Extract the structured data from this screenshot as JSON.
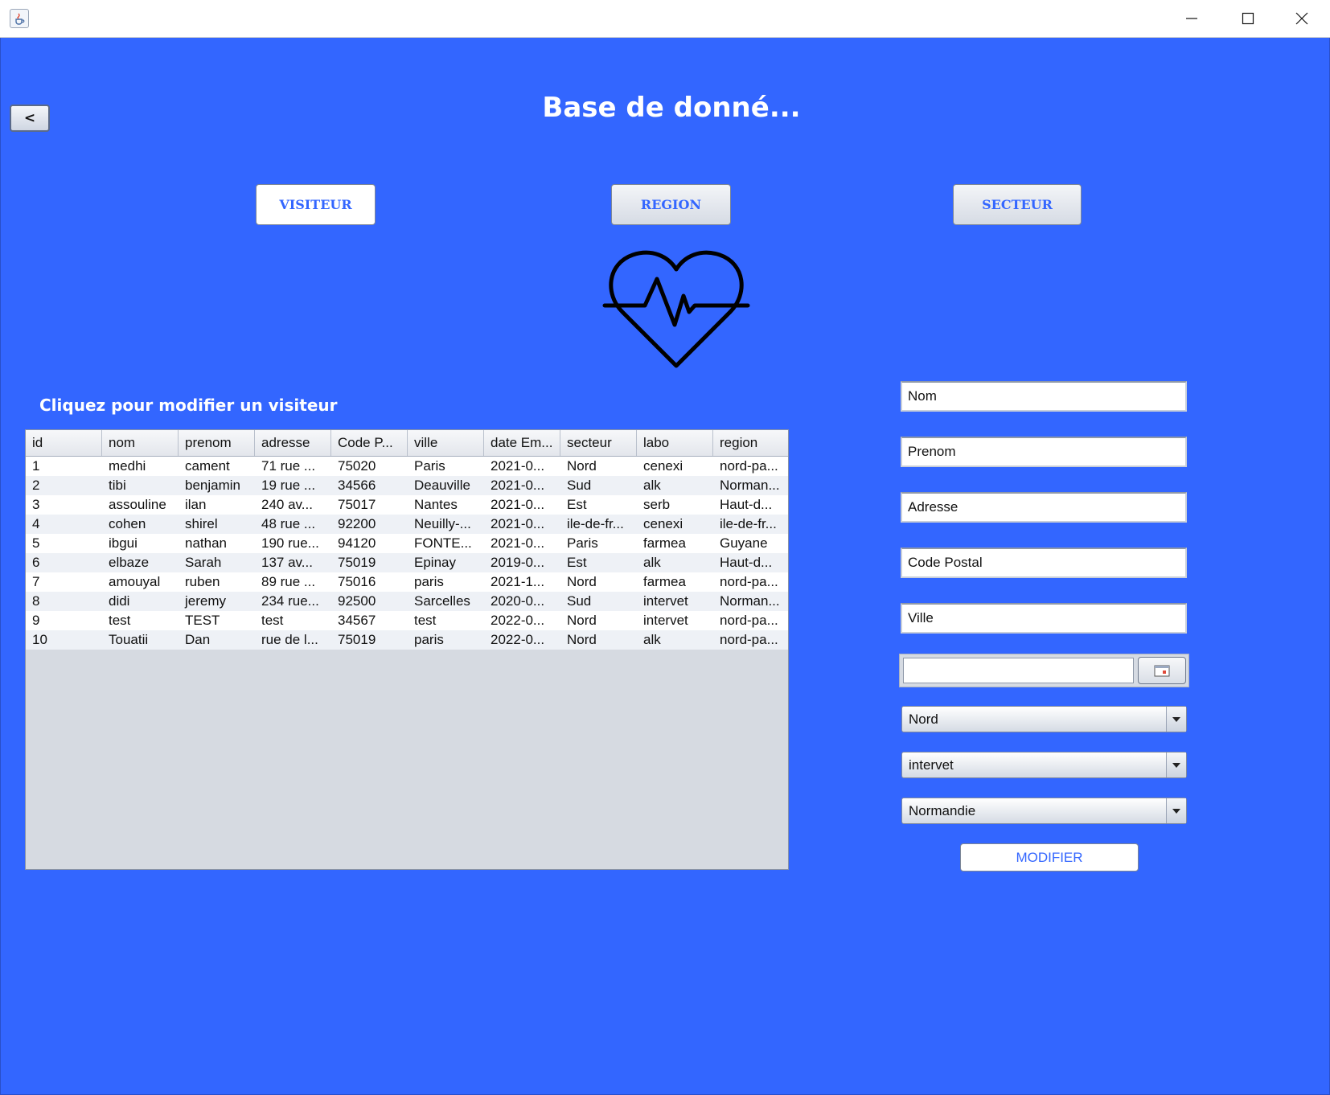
{
  "window": {
    "app_icon": "java-cup-icon",
    "controls": [
      "minimize-icon",
      "maximize-icon",
      "close-icon"
    ]
  },
  "header": {
    "back_label": "<",
    "title": "Base de donné..."
  },
  "nav": {
    "visiteur": "VISITEUR",
    "region": "REGION",
    "secteur": "SECTEUR"
  },
  "logo": "heart-pulse-icon",
  "table": {
    "caption": "Cliquez pour modifier un visiteur",
    "columns": [
      "id",
      "nom",
      "prenom",
      "adresse",
      "Code P...",
      "ville",
      "date Em...",
      "secteur",
      "labo",
      "region"
    ],
    "rows": [
      [
        "1",
        "medhi",
        "cament",
        "71 rue ...",
        "75020",
        "Paris",
        "2021-0...",
        "Nord",
        "cenexi",
        "nord-pa..."
      ],
      [
        "2",
        "tibi",
        "benjamin",
        "19 rue ...",
        "34566",
        "Deauville",
        "2021-0...",
        "Sud",
        "alk",
        "Norman..."
      ],
      [
        "3",
        "assouline",
        "ilan",
        "240 av...",
        "75017",
        "Nantes",
        "2021-0...",
        "Est",
        "serb",
        "Haut-d..."
      ],
      [
        "4",
        "cohen",
        "shirel",
        "48 rue ...",
        "92200",
        "Neuilly-...",
        "2021-0...",
        "ile-de-fr...",
        "cenexi",
        "ile-de-fr..."
      ],
      [
        "5",
        "ibgui",
        "nathan",
        "190 rue...",
        "94120",
        "FONTE...",
        "2021-0...",
        "Paris",
        "farmea",
        "Guyane"
      ],
      [
        "6",
        "elbaze",
        "Sarah",
        "137 av...",
        "75019",
        "Epinay",
        "2019-0...",
        "Est",
        "alk",
        "Haut-d..."
      ],
      [
        "7",
        "amouyal",
        "ruben",
        "89 rue ...",
        "75016",
        "paris",
        "2021-1...",
        "Nord",
        "farmea",
        "nord-pa..."
      ],
      [
        "8",
        "didi",
        "jeremy",
        "234 rue...",
        "92500",
        "Sarcelles",
        "2020-0...",
        "Sud",
        "intervet",
        "Norman..."
      ],
      [
        "9",
        "test",
        "TEST",
        "test",
        "34567",
        "test",
        "2022-0...",
        "Nord",
        "intervet",
        "nord-pa..."
      ],
      [
        "10",
        "Touatii",
        "Dan",
        "rue de l...",
        "75019",
        "paris",
        "2022-0...",
        "Nord",
        "alk",
        "nord-pa..."
      ]
    ]
  },
  "form": {
    "nom": "Nom",
    "prenom": "Prenom",
    "adresse": "Adresse",
    "code_postal": "Code Postal",
    "ville": "Ville",
    "date": "",
    "date_button_icon": "calendar-icon",
    "secteur": "Nord",
    "labo": "intervet",
    "region": "Normandie",
    "submit": "MODIFIER"
  },
  "colors": {
    "background": "#3366ff",
    "accent_text": "#3366ff"
  }
}
